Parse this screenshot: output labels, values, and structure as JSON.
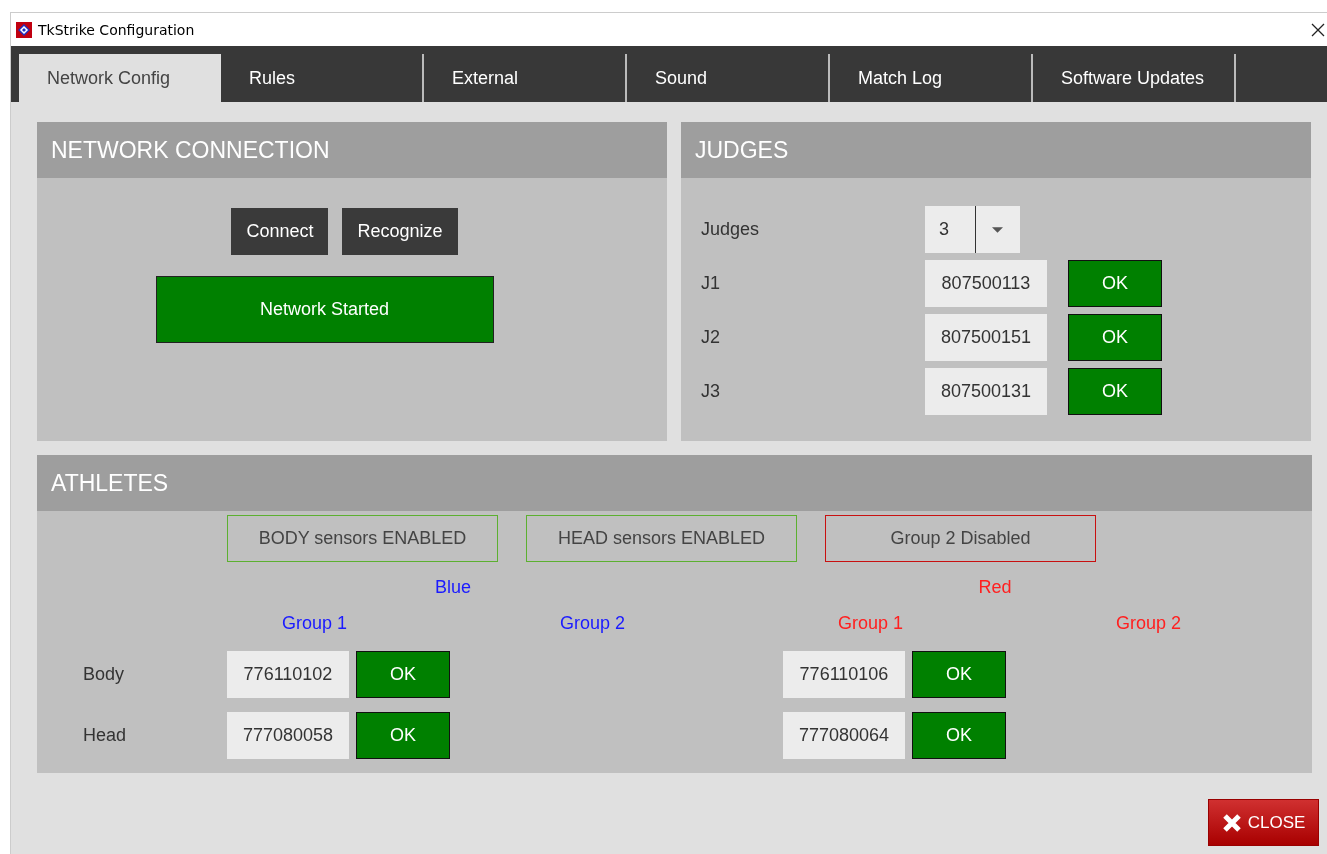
{
  "window": {
    "title": "TkStrike Configuration"
  },
  "tabs": [
    {
      "label": "Network Config",
      "selected": true
    },
    {
      "label": "Rules",
      "selected": false
    },
    {
      "label": "External",
      "selected": false
    },
    {
      "label": "Sound",
      "selected": false
    },
    {
      "label": "Match Log",
      "selected": false
    },
    {
      "label": "Software Updates",
      "selected": false
    }
  ],
  "network": {
    "title": "NETWORK CONNECTION",
    "buttons": [
      "Connect",
      "Recognize"
    ],
    "status": "Network Started"
  },
  "judges": {
    "title": "JUDGES",
    "count_label": "Judges",
    "count": "3",
    "rows": [
      {
        "label": "J1",
        "id": "807500113",
        "status": "OK"
      },
      {
        "label": "J2",
        "id": "807500151",
        "status": "OK"
      },
      {
        "label": "J3",
        "id": "807500131",
        "status": "OK"
      }
    ]
  },
  "athletes": {
    "title": "ATHLETES",
    "sensor_states": [
      {
        "label": "BODY sensors ENABLED",
        "enabled": true
      },
      {
        "label": "HEAD sensors ENABLED",
        "enabled": true
      },
      {
        "label": "Group 2 Disabled",
        "enabled": false
      }
    ],
    "sides": [
      {
        "name": "Blue",
        "color": "#1a1aff",
        "groups": [
          "Group 1",
          "Group 2"
        ]
      },
      {
        "name": "Red",
        "color": "#ff2020",
        "groups": [
          "Group 1",
          "Group 2"
        ]
      }
    ],
    "rows": [
      {
        "label": "Body",
        "sensors": [
          {
            "id": "776110102",
            "status": "OK"
          },
          {
            "id": "776110106",
            "status": "OK"
          }
        ]
      },
      {
        "label": "Head",
        "sensors": [
          {
            "id": "777080058",
            "status": "OK"
          },
          {
            "id": "777080064",
            "status": "OK"
          }
        ]
      }
    ]
  },
  "close_button": "CLOSE"
}
